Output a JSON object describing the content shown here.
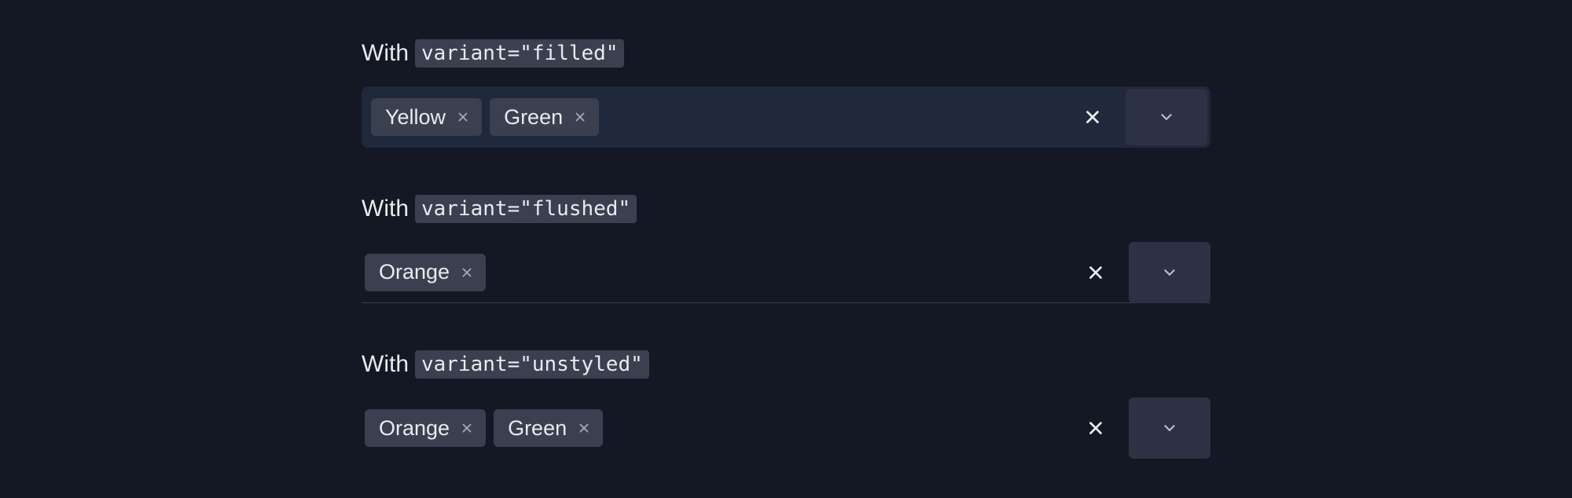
{
  "examples": [
    {
      "prefix": "With",
      "code": "variant=\"filled\"",
      "variant": "filled",
      "tags": [
        "Yellow",
        "Green"
      ]
    },
    {
      "prefix": "With",
      "code": "variant=\"flushed\"",
      "variant": "flushed",
      "tags": [
        "Orange"
      ]
    },
    {
      "prefix": "With",
      "code": "variant=\"unstyled\"",
      "variant": "unstyled",
      "tags": [
        "Orange",
        "Green"
      ]
    }
  ]
}
